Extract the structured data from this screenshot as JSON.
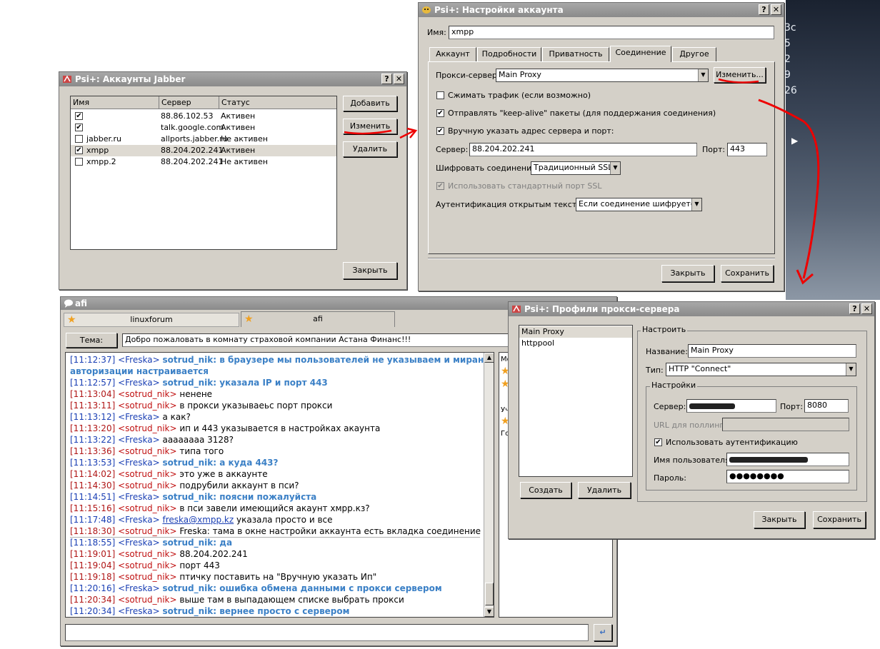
{
  "desktop": {
    "numbers": [
      "3c",
      "5",
      "2",
      "9",
      "26"
    ]
  },
  "accounts_window": {
    "title": "Psi+: Аккаунты Jabber",
    "columns": [
      "Имя",
      "Сервер",
      "Статус"
    ],
    "rows": [
      {
        "name": "",
        "server": "88.86.102.53",
        "status": "Активен",
        "checked": true
      },
      {
        "name": "",
        "server": "talk.google.com",
        "status": "Активен",
        "checked": true
      },
      {
        "name": "jabber.ru",
        "server": "allports.jabber.ru",
        "status": "Не активен",
        "checked": false
      },
      {
        "name": "xmpp",
        "server": "88.204.202.241",
        "status": "Активен",
        "checked": true
      },
      {
        "name": "xmpp.2",
        "server": "88.204.202.241",
        "status": "Не активен",
        "checked": false
      }
    ],
    "add_label": "Добавить",
    "edit_label": "Изменить",
    "delete_label": "Удалить",
    "close_label": "Закрыть"
  },
  "settings_window": {
    "title": "Psi+: Настройки аккаунта",
    "name_label": "Имя:",
    "name_value": "xmpp",
    "tabs": [
      "Аккаунт",
      "Подробности",
      "Приватность",
      "Соединение",
      "Другое"
    ],
    "active_tab": "Соединение",
    "proxy_label": "Прокси-сервер:",
    "proxy_value": "Main Proxy",
    "proxy_edit_label": "Изменить...",
    "compress_label": "Сжимать трафик (если возможно)",
    "keepalive_label": "Отправлять \"keep-alive\" пакеты (для поддержания соединения)",
    "manual_label": "Вручную указать адрес сервера и порт:",
    "server_label": "Сервер:",
    "server_value": "88.204.202.241",
    "port_label": "Порт:",
    "port_value": "443",
    "encrypt_label": "Шифровать соединение:",
    "encrypt_value": "Традиционный SSL",
    "ssl_port_label": "Использовать стандартный порт SSL",
    "plain_auth_label": "Аутентификация открытым текстом:",
    "plain_auth_value": "Если соединение шифруется",
    "close_label": "Закрыть",
    "save_label": "Сохранить"
  },
  "chat_window": {
    "title": "afi",
    "tabs": [
      "linuxforum",
      "afi"
    ],
    "topic_label": "Тема:",
    "topic_value": "Добро пожаловать в комнату страховой компании Астана Финанс!!!",
    "messages": [
      {
        "ts": "[11:12:37]",
        "nick": "<Freska>",
        "text": "sotrud_nik: в браузере мы пользователей не указываем и миранда без",
        "own": false,
        "hl": true
      },
      {
        "ts": "",
        "nick": "",
        "text": "авторизации настраивается",
        "own": false,
        "hl": true
      },
      {
        "ts": "[11:12:57]",
        "nick": "<Freska>",
        "text": "sotrud_nik: указала IP и порт 443",
        "own": false,
        "hl": true
      },
      {
        "ts": "[11:13:04]",
        "nick": "<sotrud_nik>",
        "text": "ненене",
        "own": true,
        "hl": false
      },
      {
        "ts": "[11:13:11]",
        "nick": "<sotrud_nik>",
        "text": "в прокси указываеьс порт прокси",
        "own": true,
        "hl": false
      },
      {
        "ts": "[11:13:12]",
        "nick": "<Freska>",
        "text": "а как?",
        "own": false,
        "hl": false
      },
      {
        "ts": "[11:13:20]",
        "nick": "<sotrud_nik>",
        "text": "ип и 443 указывается в настройках акаунта",
        "own": true,
        "hl": false
      },
      {
        "ts": "[11:13:22]",
        "nick": "<Freska>",
        "text": "аааааааа 3128?",
        "own": false,
        "hl": false
      },
      {
        "ts": "[11:13:36]",
        "nick": "<sotrud_nik>",
        "text": "типа того",
        "own": true,
        "hl": false
      },
      {
        "ts": "[11:13:53]",
        "nick": "<Freska>",
        "text": "sotrud_nik: а куда 443?",
        "own": false,
        "hl": true
      },
      {
        "ts": "[11:14:02]",
        "nick": "<sotrud_nik>",
        "text": "это уже в аккаунте",
        "own": true,
        "hl": false
      },
      {
        "ts": "[11:14:30]",
        "nick": "<sotrud_nik>",
        "text": "подрубили аккаунт в пси?",
        "own": true,
        "hl": false
      },
      {
        "ts": "[11:14:51]",
        "nick": "<Freska>",
        "text": "sotrud_nik: поясни пожалуйста",
        "own": false,
        "hl": true
      },
      {
        "ts": "[11:15:16]",
        "nick": "<sotrud_nik>",
        "text": "в пси завели имеющийся акаунт хмрр.кз?",
        "own": true,
        "hl": false
      },
      {
        "ts": "[11:17:48]",
        "nick": "<Freska>",
        "text": "указала просто и все",
        "link": "freska@xmpp.kz",
        "own": false,
        "hl": false
      },
      {
        "ts": "[11:18:30]",
        "nick": "<sotrud_nik>",
        "text": "Freska: тама в окне настройки аккаунта есть вкладка соединение",
        "own": true,
        "hl": false
      },
      {
        "ts": "[11:18:55]",
        "nick": "<Freska>",
        "text": "sotrud_nik: да",
        "own": false,
        "hl": true
      },
      {
        "ts": "[11:19:01]",
        "nick": "<sotrud_nik>",
        "text": "88.204.202.241",
        "own": true,
        "hl": false
      },
      {
        "ts": "[11:19:04]",
        "nick": "<sotrud_nik>",
        "text": "порт 443",
        "own": true,
        "hl": false
      },
      {
        "ts": "[11:19:18]",
        "nick": "<sotrud_nik>",
        "text": "птичку поставить на \"Вручную указать Ип\"",
        "own": true,
        "hl": false
      },
      {
        "ts": "[11:20:16]",
        "nick": "<Freska>",
        "text": "sotrud_nik: ошибка обмена данными с прокси сервером",
        "own": false,
        "hl": true
      },
      {
        "ts": "[11:20:34]",
        "nick": "<sotrud_nik>",
        "text": "выше там в выпадающем списке выбрать прокси",
        "own": true,
        "hl": false
      },
      {
        "ts": "[11:20:34]",
        "nick": "<Freska>",
        "text": "sotrud_nik: вернее просто с сервером",
        "own": false,
        "hl": true
      }
    ],
    "side_labels": [
      "Mo",
      "Уч",
      "Го"
    ]
  },
  "proxy_window": {
    "title": "Psi+: Профили прокси-сервера",
    "profiles": [
      "Main Proxy",
      "httppool"
    ],
    "create_label": "Создать",
    "delete_label": "Удалить",
    "configure_label": "Настроить",
    "name_label": "Название:",
    "name_value": "Main Proxy",
    "type_label": "Тип:",
    "type_value": "HTTP \"Connect\"",
    "settings_label": "Настройки",
    "server_label": "Сервер:",
    "port_label": "Порт:",
    "port_value": "8080",
    "url_label": "URL для поллинга:",
    "auth_label": "Использовать аутентификацию",
    "user_label": "Имя пользователя:",
    "password_label": "Пароль:",
    "password_value": "●●●●●●●●",
    "close_label": "Закрыть",
    "save_label": "Сохранить"
  }
}
